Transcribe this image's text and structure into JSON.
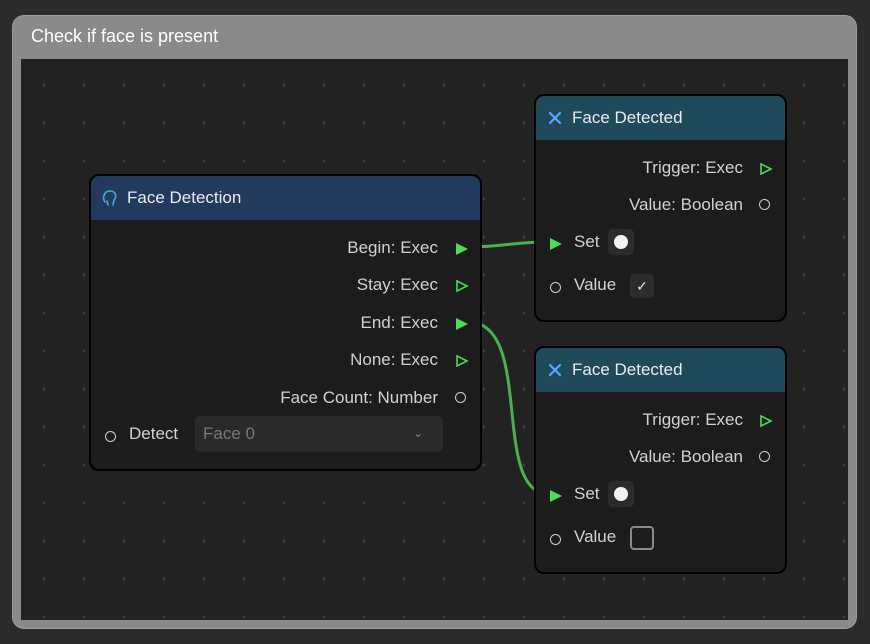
{
  "group": {
    "title": "Check if face is present"
  },
  "colors": {
    "exec_pin": "#4ade50",
    "wire": "#4caf50",
    "header_blue": "#223a5e",
    "header_teal": "#1e4a5c"
  },
  "face_detection": {
    "title": "Face Detection",
    "icon": "face-outline-icon",
    "outputs": {
      "begin": "Begin: Exec",
      "stay": "Stay: Exec",
      "end": "End: Exec",
      "none": "None: Exec",
      "face_count": "Face Count: Number"
    },
    "detect_label": "Detect",
    "detect_value": "Face 0"
  },
  "face_detected_1": {
    "title": "Face Detected",
    "icon": "variable-x-icon",
    "trigger": "Trigger: Exec",
    "value_out": "Value: Boolean",
    "set_label": "Set",
    "value_label": "Value",
    "value_checked": true
  },
  "face_detected_2": {
    "title": "Face Detected",
    "icon": "variable-x-icon",
    "trigger": "Trigger: Exec",
    "value_out": "Value: Boolean",
    "set_label": "Set",
    "value_label": "Value",
    "value_checked": false
  }
}
